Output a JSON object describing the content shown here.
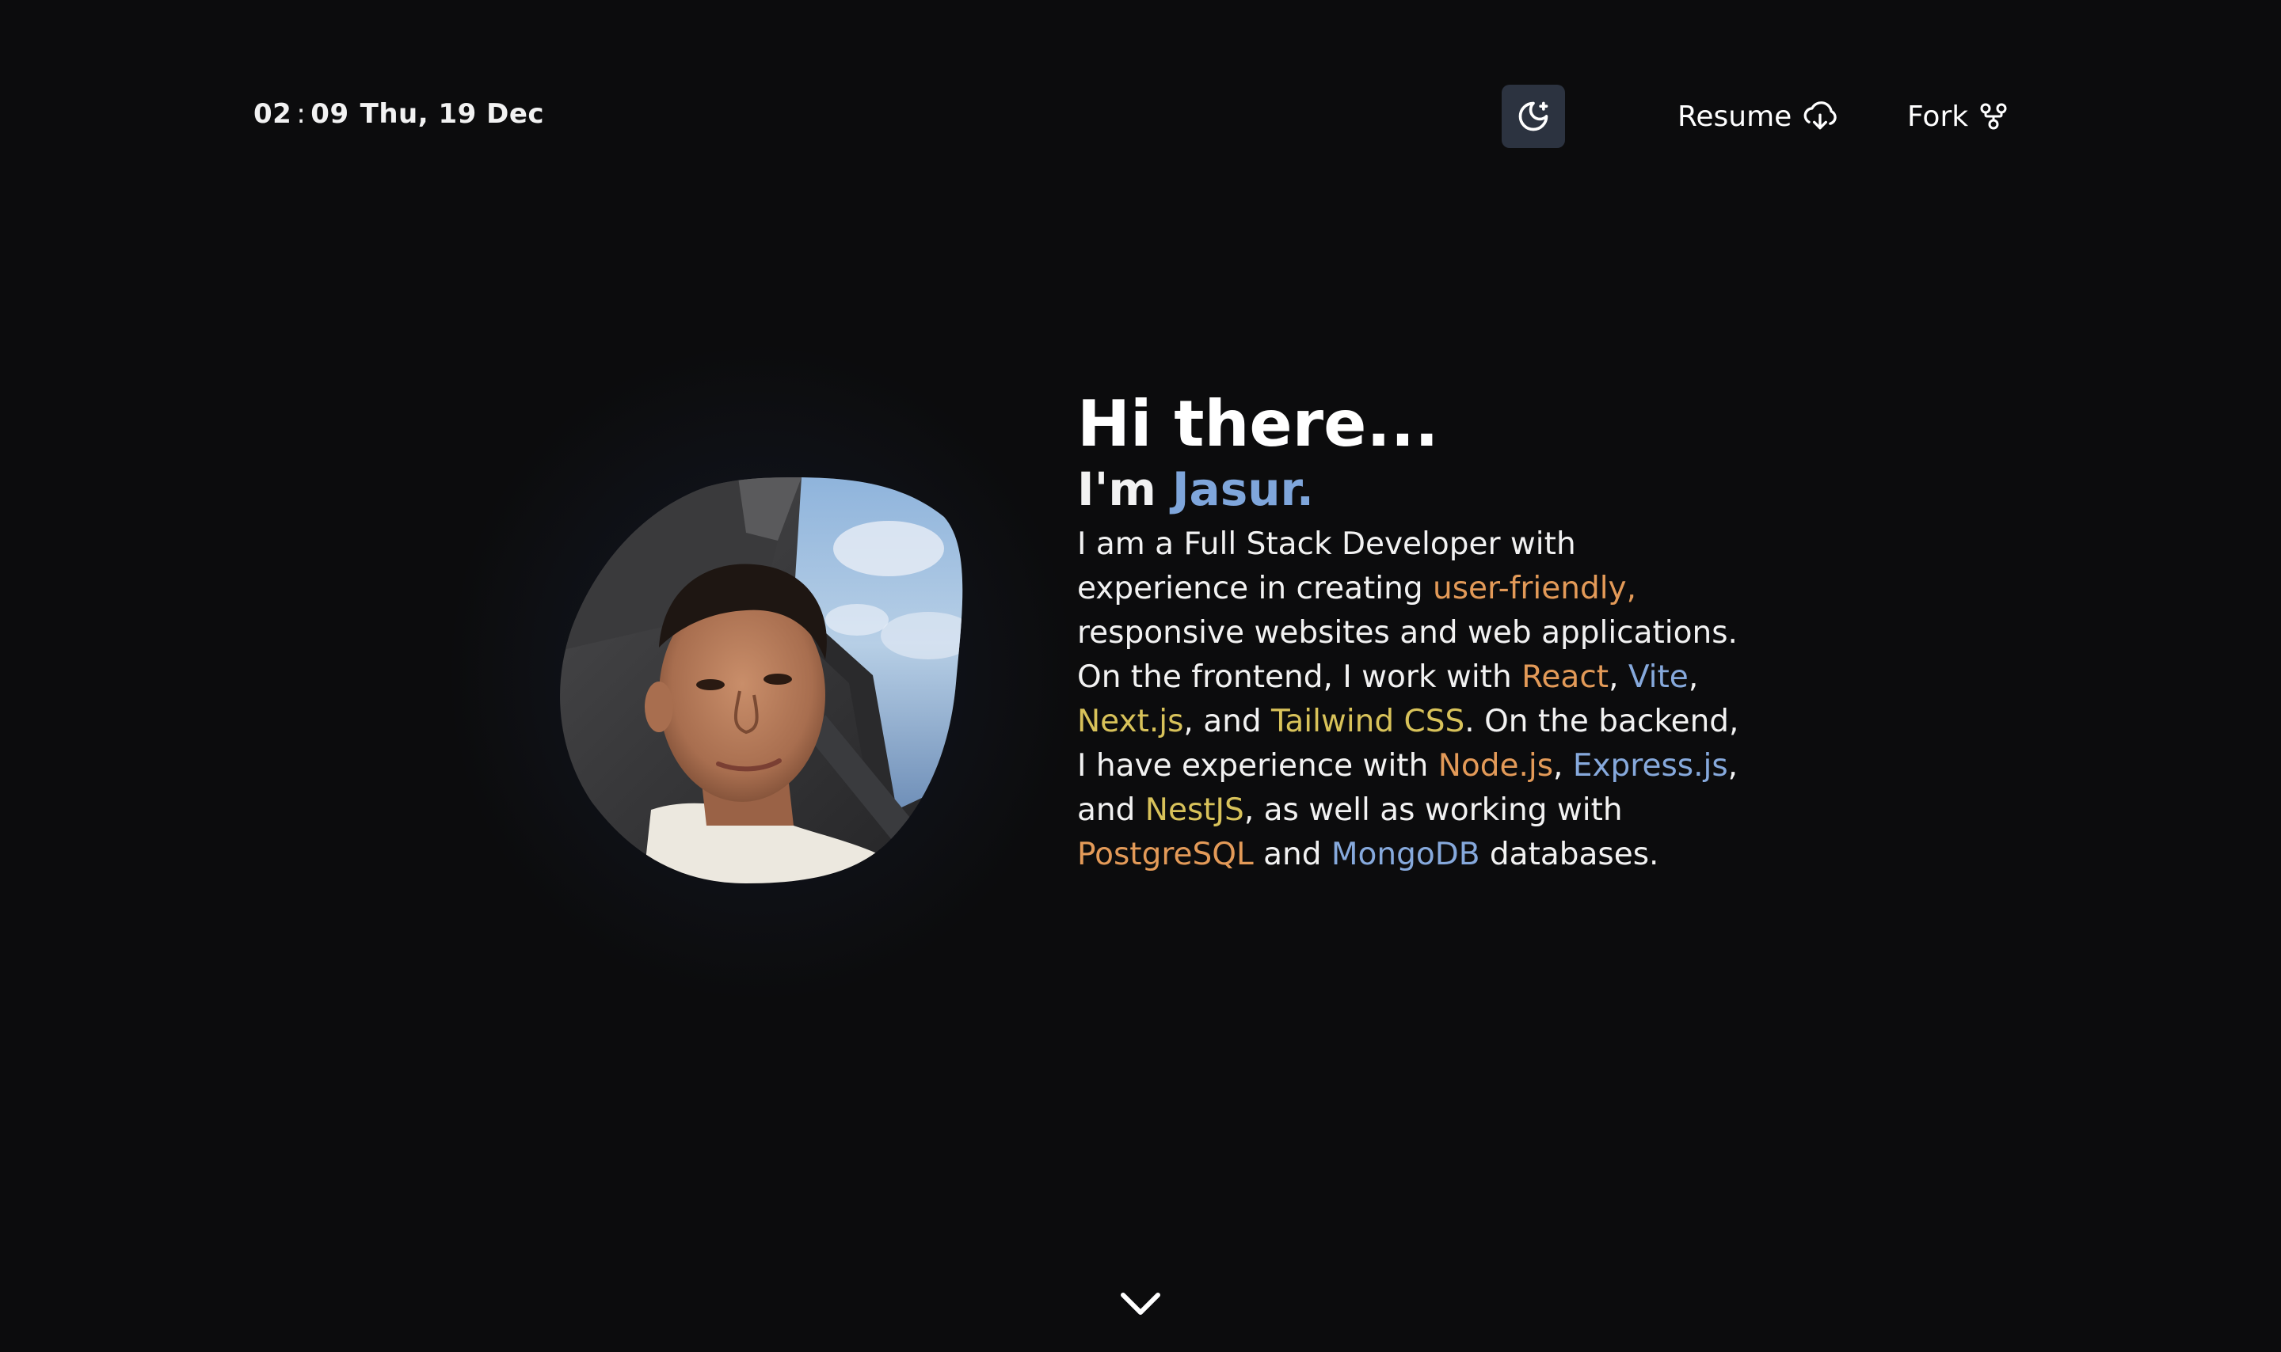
{
  "header": {
    "time_hours": "02",
    "time_separator": ":",
    "time_minutes": "09",
    "date": "Thu, 19 Dec",
    "theme_toggle_icon": "moon-stars-icon",
    "resume_label": "Resume",
    "resume_icon": "cloud-download-icon",
    "fork_label": "Fork",
    "fork_icon": "git-fork-icon"
  },
  "hero": {
    "greeting": "Hi there...",
    "name_prefix": "I'm ",
    "name": "Jasur.",
    "avatar_alt": "profile photo",
    "bio": {
      "l1": "I am a Full Stack Developer with",
      "l2_a": "experience in creating ",
      "l2_hl": "user-friendly,",
      "l3": "responsive websites and web applications.",
      "l4_a": "On the frontend, I work with ",
      "l4_react": "React",
      "l4_comma": ", ",
      "l4_vite": "Vite",
      "l4_end": ",",
      "l5_next": "Next.js",
      "l5_and": ", and ",
      "l5_tailwind": "Tailwind CSS",
      "l5_end": ". On the backend,",
      "l6_a": "I have experience with ",
      "l6_node": "Node.js",
      "l6_comma": ", ",
      "l6_express": "Express.js",
      "l6_end": ",",
      "l7_a": "and ",
      "l7_nest": "NestJS",
      "l7_end": ", as well as working with",
      "l8_pg": "PostgreSQL",
      "l8_and": " and ",
      "l8_mongo": "MongoDB",
      "l8_end": " databases."
    }
  },
  "footer": {
    "scroll_icon": "chevron-down-icon"
  },
  "colors": {
    "background": "#0c0c0d",
    "name_accent": "#7fa6db",
    "orange": "#e39a58",
    "blue": "#86a9dc",
    "yellow": "#d8c25a",
    "toggle_bg": "#2c3340"
  }
}
